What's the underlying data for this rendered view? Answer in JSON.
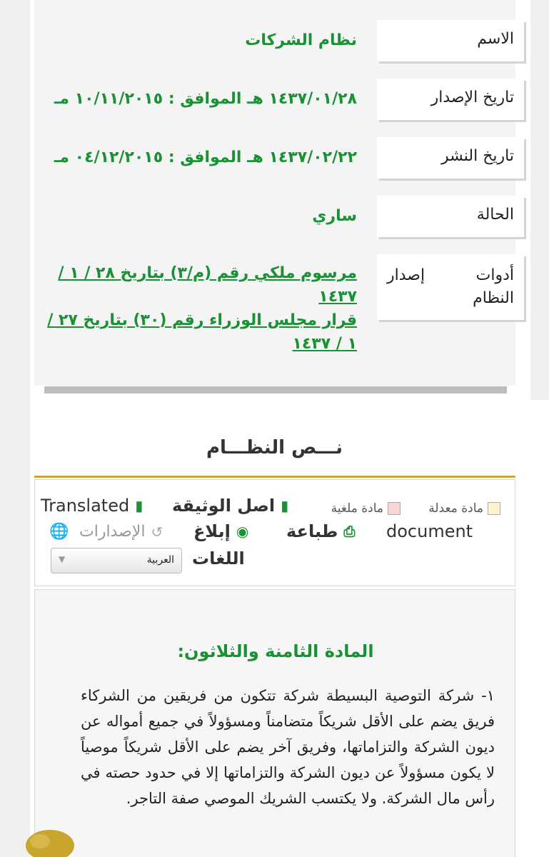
{
  "info": {
    "rows": [
      {
        "label": "الاسم",
        "value": "نظام الشركات"
      },
      {
        "label": "تاريخ الإصدار",
        "value": "١٤٣٧/٠١/٢٨ هـ الموافق : ١٠/١١/٢٠١٥ مـ"
      },
      {
        "label": "تاريخ النشر",
        "value": "١٤٣٧/٠٢/٢٢ هـ الموافق : ٠٤/١٢/٢٠١٥ مـ"
      },
      {
        "label": "الحالة",
        "value": "ساري"
      }
    ],
    "tools_label_word1": "أدوات",
    "tools_label_word2": "إصدار",
    "tools_label_word3": "النظام",
    "tools_links": [
      "مرسوم ملكي رقم (م/٣) بتاريخ ٢٨ / ١ / ١٤٣٧",
      "قرار مجلس الوزراء رقم (٣٠) بتاريخ ٢٧ / ١ / ١٤٣٧"
    ]
  },
  "section_title": "نـــص النظـــام",
  "toolbar": {
    "legend_amended": "مادة معدلة",
    "legend_cancelled": "مادة ملغية",
    "original_doc": "اصل الوثيقة",
    "translated_word": "Translated",
    "document_word": "document",
    "print": "طباعة",
    "report": "إبلاغ",
    "versions": "الإصدارات",
    "languages": "اللغات",
    "language_selected": "العربية"
  },
  "colors": {
    "green": "#1a9134",
    "gold": "#c8a52d",
    "amended_swatch": "#fdf3cf",
    "cancelled_swatch": "#f9d6d6"
  },
  "article": {
    "title": "المادة الثامنة والثلاثون:",
    "text": "١- شركة التوصية البسيطة شركة تتكون من فريقين من الشركاء فريق يضم على الأقل شريكاً متضامناً ومسؤولاً في جميع أمواله عن ديون الشركة والتزاماتها، وفريق آخر يضم على الأقل شريكاً موصياً لا يكون مسؤولاً عن ديون الشركة والتزاماتها إلا في حدود حصته في رأس مال الشركة. ولا يكتسب الشريك الموصي صفة التاجر."
  }
}
